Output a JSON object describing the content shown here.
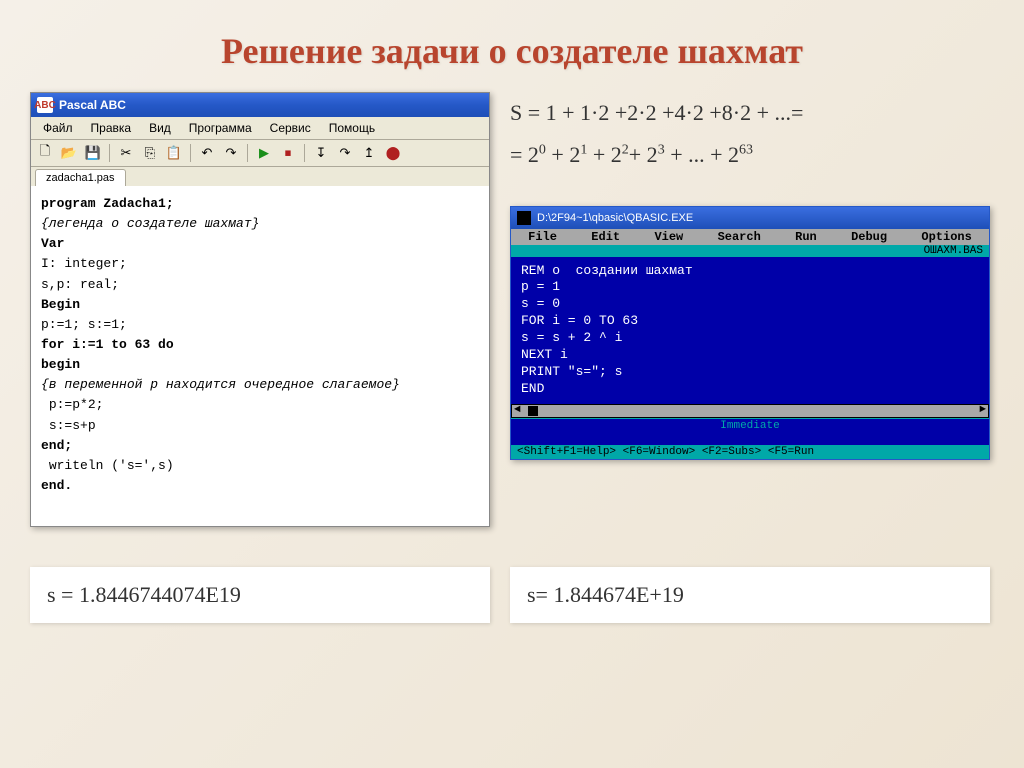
{
  "slide": {
    "title": "Решение задачи о создателе шахмат"
  },
  "pascal": {
    "window_title": "Pascal ABC",
    "icon_text": "ABC",
    "menu": [
      "Файл",
      "Правка",
      "Вид",
      "Программа",
      "Сервис",
      "Помощь"
    ],
    "tab": "zadacha1.pas",
    "code_lines": [
      {
        "kw": true,
        "t": "program Zadacha1;"
      },
      {
        "cm": true,
        "t": "{легенда о создателе шахмат}"
      },
      {
        "kw": true,
        "t": "Var"
      },
      {
        "t": "I: integer;"
      },
      {
        "t": "s,p: real;"
      },
      {
        "kw": true,
        "t": "Begin"
      },
      {
        "t": "p:=1; s:=1;"
      },
      {
        "kw": true,
        "t": "for i:=1 to 63 do"
      },
      {
        "kw": true,
        "t": "begin"
      },
      {
        "cm": true,
        "t": "{в переменной p находится очередное слагаемое}"
      },
      {
        "t": " p:=p*2;"
      },
      {
        "t": " s:=s+p"
      },
      {
        "kw": true,
        "t": "end;"
      },
      {
        "t": " writeln ('s=',s)"
      },
      {
        "kw": true,
        "t": "end."
      }
    ]
  },
  "toolbar_icons": [
    "new-file-icon",
    "open-icon",
    "save-icon",
    "sep",
    "cut-icon",
    "copy-icon",
    "paste-icon",
    "sep",
    "undo-icon",
    "redo-icon",
    "sep",
    "run-icon",
    "stop-icon",
    "sep",
    "step-into-icon",
    "step-over-icon",
    "step-out-icon",
    "breakpoint-icon"
  ],
  "toolbar_glyphs": {
    "new-file-icon": "🗋",
    "open-icon": "📂",
    "save-icon": "💾",
    "cut-icon": "✂",
    "copy-icon": "⎘",
    "paste-icon": "📋",
    "undo-icon": "↶",
    "redo-icon": "↷",
    "run-icon": "▶",
    "stop-icon": "⏹",
    "step-into-icon": "↧",
    "step-over-icon": "↷",
    "step-out-icon": "↥",
    "breakpoint-icon": "⬤"
  },
  "formula": {
    "line1_html": "S = 1 + 1·2 +2·2 +4·2 +8·2 + ...=",
    "line2_html": "= 2<sup>0</sup> + 2<sup>1</sup> + 2<sup>2</sup>+ 2<sup>3</sup> + ... + 2<sup>63</sup>"
  },
  "qbasic": {
    "title": "D:\\2F94~1\\qbasic\\QBASIC.EXE",
    "menu": [
      "File",
      "Edit",
      "View",
      "Search",
      "Run",
      "Debug",
      "Options"
    ],
    "filename": "ОШАХМ.BAS",
    "code": "REM о  создании шахмат\np = 1\ns = 0\nFOR i = 0 TO 63\ns = s + 2 ^ i\nNEXT i\nPRINT \"s=\"; s\nEND",
    "immediate": "Immediate",
    "status": "<Shift+F1=Help> <F6=Window> <F2=Subs> <F5=Run"
  },
  "results": {
    "left": "s = 1.8446744074E19",
    "right": "s= 1.844674E+19"
  }
}
